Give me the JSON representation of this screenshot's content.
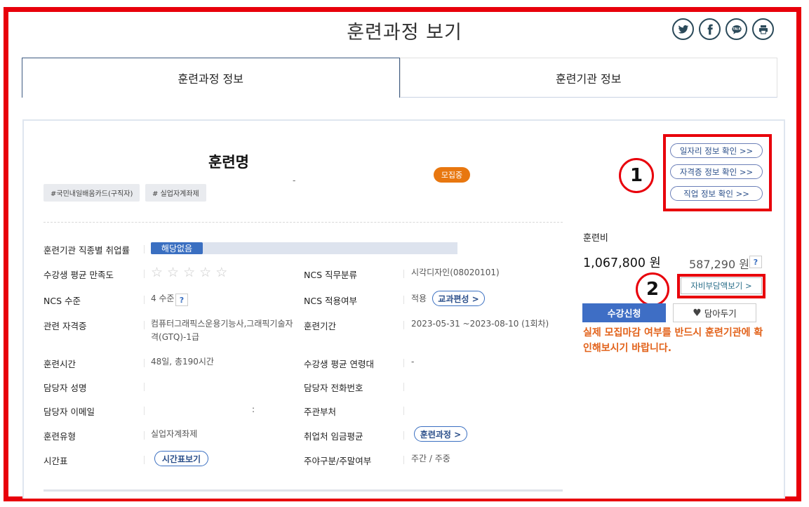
{
  "page": {
    "title": "훈련과정 보기"
  },
  "share": {
    "twitter": "twitter-icon",
    "facebook": "facebook-icon",
    "talk": "talk",
    "print": "print-icon"
  },
  "tabs": [
    {
      "label": "훈련과정 정보"
    },
    {
      "label": "훈련기관 정보"
    }
  ],
  "course": {
    "name": "훈련명",
    "dash": "-",
    "badge": "모집중",
    "tags": [
      "#국민내일배움카드(구직자)",
      "# 실업자계좌제"
    ]
  },
  "info": {
    "employment_rate_label": "훈련기관 직종별 취업률",
    "employment_rate_value": "해당없음",
    "employment_rate_fraction": 0.17,
    "satisfaction_label": "수강생 평균 만족도",
    "satisfaction_stars": 0,
    "ncs_category_label": "NCS 직무분류",
    "ncs_category_value": "시각디자인(08020101)",
    "ncs_level_label": "NCS 수준",
    "ncs_level_value": "4 수준",
    "ncs_apply_label": "NCS 적용여부",
    "ncs_apply_value": "적용",
    "curriculum_button": "교과편성 >",
    "cert_label": "관련 자격증",
    "cert_value": "컴퓨터그래픽스운용기능사,그래픽기술자격(GTQ)-1급",
    "period_label": "훈련기간",
    "period_value": "2023-05-31 ~2023-08-10 (1회차)",
    "hours_label": "훈련시간",
    "hours_value": "48일, 총190시간",
    "age_label": "수강생 평균 연령대",
    "age_value": "-",
    "manager_label": "담당자 성명",
    "manager_phone_label": "담당자 전화번호",
    "manager_email_label": "담당자 이메일",
    "email_colon": ":",
    "dept_label": "주관부처",
    "type_label": "훈련유형",
    "type_value": "실업자계좌제",
    "wage_label": "취업처 임금평균",
    "wage_button": "훈련과정 >",
    "schedule_label": "시간표",
    "schedule_button": "시간표보기",
    "daynight_label": "주야구분/주말여부",
    "daynight_value": "주간 / 주중",
    "question_mark": "?"
  },
  "side": {
    "job_info": "일자리 정보 확인 >>",
    "cert_info": "자격증 정보 확인 >>",
    "occupation_info": "직업 정보 확인 >>",
    "fee_label": "훈련비",
    "fee_total": "1,067,800 원",
    "fee_self": "587,290 원",
    "self_pay_button": "자비부담액보기 >",
    "apply_button": "수강신청",
    "save_button": "담아두기",
    "notice": "실제 모집마감 여부를 반드시 훈련기관에 확인해보시기 바랍니다."
  },
  "annotations": {
    "one": "1",
    "two": "2"
  },
  "colors": {
    "accent": "#3e6ec5",
    "badge": "#e8770f",
    "notice": "#e2621a",
    "highlight": "#e8000b"
  }
}
